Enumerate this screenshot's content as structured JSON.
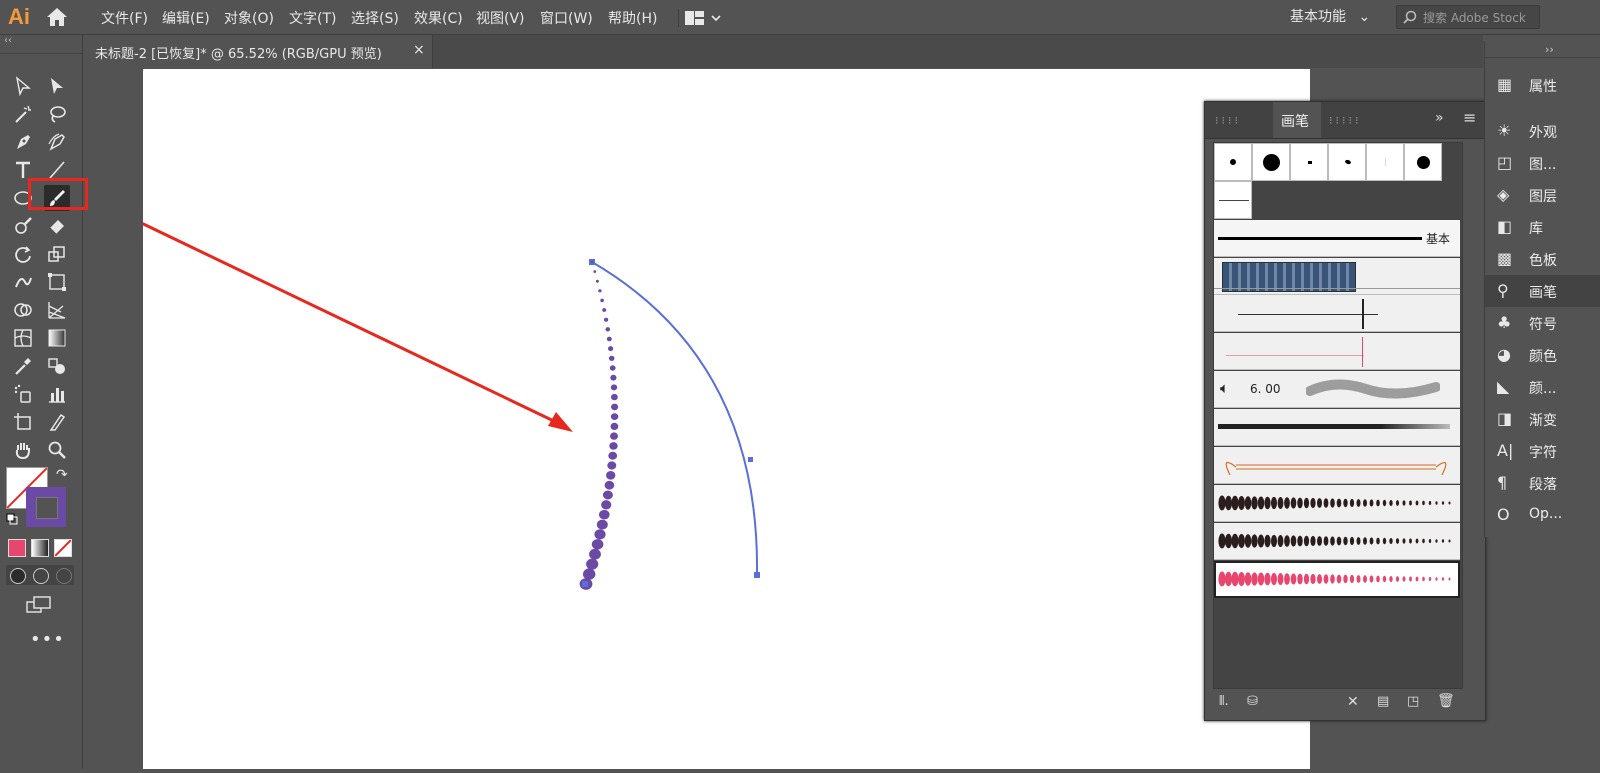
{
  "app": {
    "logo": "Ai",
    "menus": [
      "文件(F)",
      "编辑(E)",
      "对象(O)",
      "文字(T)",
      "选择(S)",
      "效果(C)",
      "视图(V)",
      "窗口(W)",
      "帮助(H)"
    ],
    "workspace": "基本功能",
    "search_placeholder": "搜索 Adobe Stock"
  },
  "document": {
    "tab_title": "未标题-2 [已恢复]* @ 65.52% (RGB/GPU 预览)",
    "close_glyph": "×"
  },
  "brush_panel": {
    "tab_label": "画笔",
    "basic_label": "基本",
    "size_value": "6. 00"
  },
  "dock": {
    "items": [
      {
        "label": "属性",
        "icon": "properties-icon"
      },
      {
        "label": "外观",
        "icon": "appearance-icon"
      },
      {
        "label": "图...",
        "icon": "graphic-styles-icon"
      },
      {
        "label": "图层",
        "icon": "layers-icon"
      },
      {
        "label": "库",
        "icon": "libraries-icon"
      },
      {
        "label": "色板",
        "icon": "swatches-icon"
      },
      {
        "label": "画笔",
        "icon": "brushes-icon"
      },
      {
        "label": "符号",
        "icon": "symbols-icon"
      },
      {
        "label": "颜色",
        "icon": "color-icon"
      },
      {
        "label": "颜...",
        "icon": "color-guide-icon"
      },
      {
        "label": "渐变",
        "icon": "gradient-icon"
      },
      {
        "label": "字符",
        "icon": "character-icon"
      },
      {
        "label": "段落",
        "icon": "paragraph-icon"
      },
      {
        "label": "Op...",
        "icon": "opentype-icon"
      }
    ]
  },
  "colors": {
    "accent_brand": "#f29a3c",
    "annotation_red": "#e8281e",
    "stroke_purple": "#6b4aa6",
    "path_blue": "#5a6fd8",
    "pink_brush": "#e8456f"
  }
}
